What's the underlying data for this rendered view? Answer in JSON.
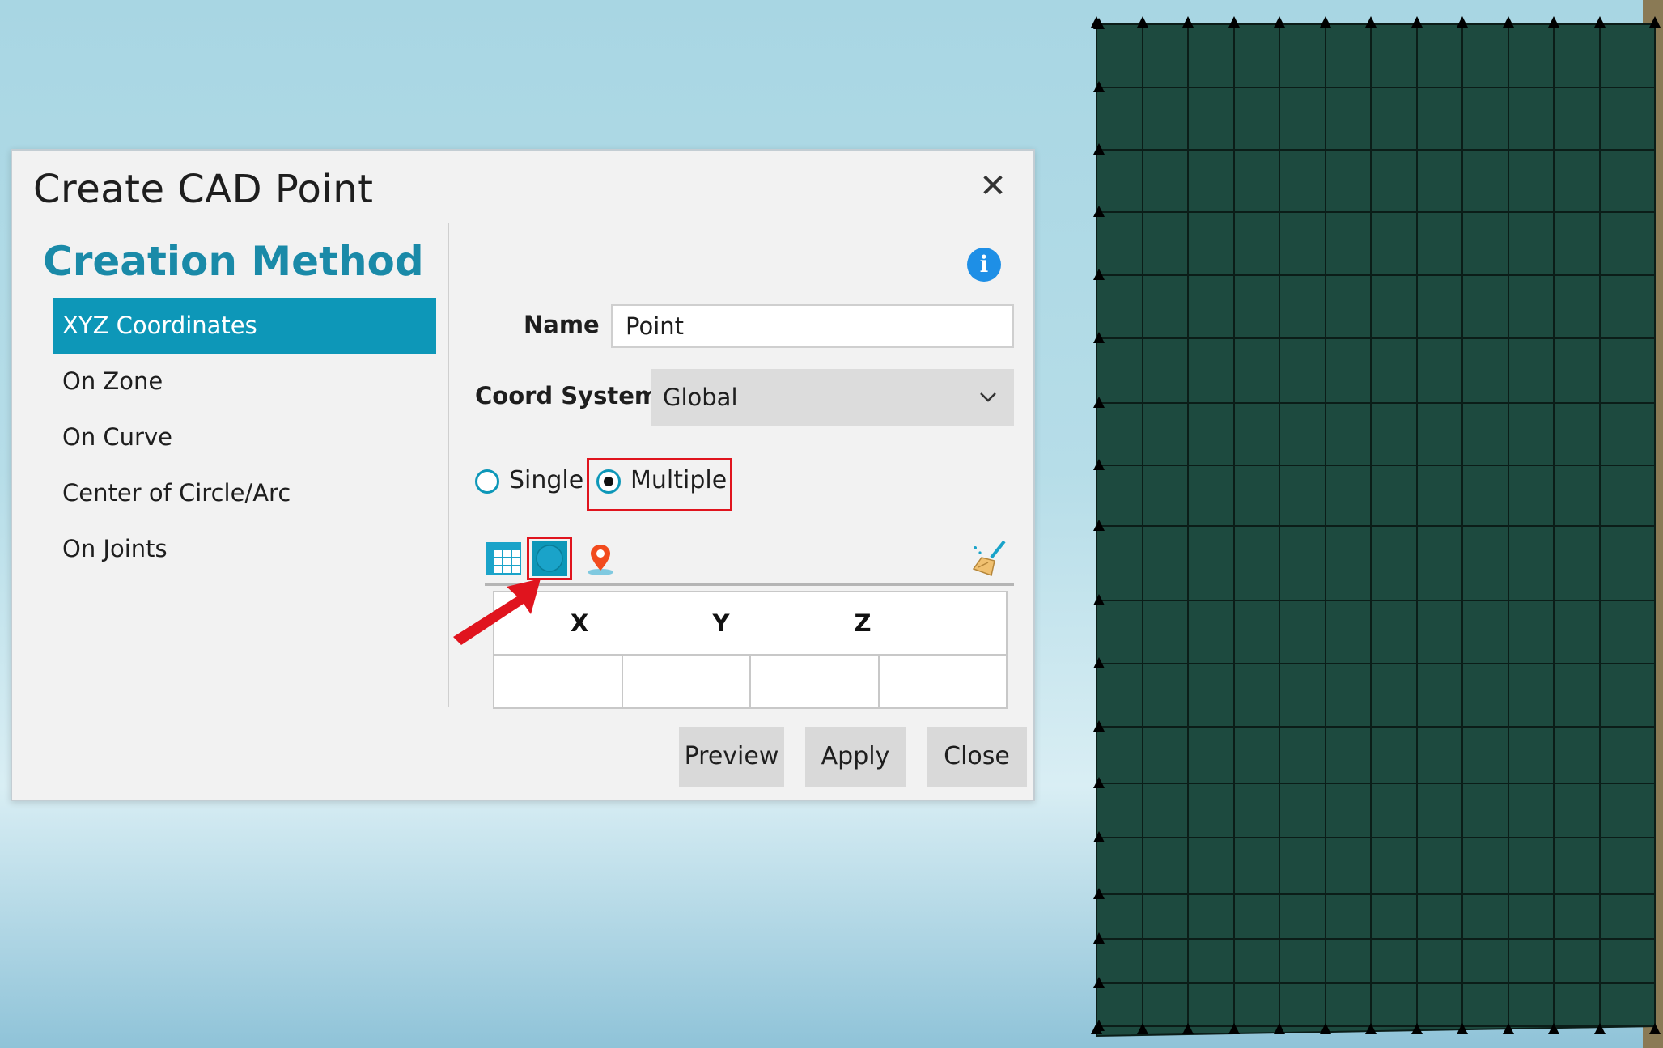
{
  "dialog": {
    "title": "Create CAD Point",
    "close_glyph": "✕"
  },
  "creation_method": {
    "heading": "Creation Method",
    "items": [
      {
        "label": "XYZ Coordinates",
        "active": true
      },
      {
        "label": "On Zone",
        "active": false
      },
      {
        "label": "On Curve",
        "active": false
      },
      {
        "label": "Center of Circle/Arc",
        "active": false
      },
      {
        "label": "On Joints",
        "active": false
      }
    ]
  },
  "form": {
    "info_glyph": "i",
    "name_label": "Name",
    "name_value": "Point",
    "coord_label": "Coord System",
    "coord_value": "Global",
    "mode_single": "Single",
    "mode_multiple": "Multiple",
    "selected_mode": "Multiple"
  },
  "table": {
    "columns": [
      "X",
      "Y",
      "Z"
    ]
  },
  "buttons": {
    "preview": "Preview",
    "apply": "Apply",
    "close": "Close"
  },
  "icons": [
    "table-grid-icon",
    "point-circle-icon",
    "map-pin-icon",
    "broom-clear-icon",
    "info-icon",
    "chevron-down-icon",
    "close-icon"
  ],
  "colors": {
    "accent": "#0d97b8",
    "heading": "#1a8aa8",
    "highlight": "#e0141e",
    "mesh": "#1d4a3f"
  }
}
